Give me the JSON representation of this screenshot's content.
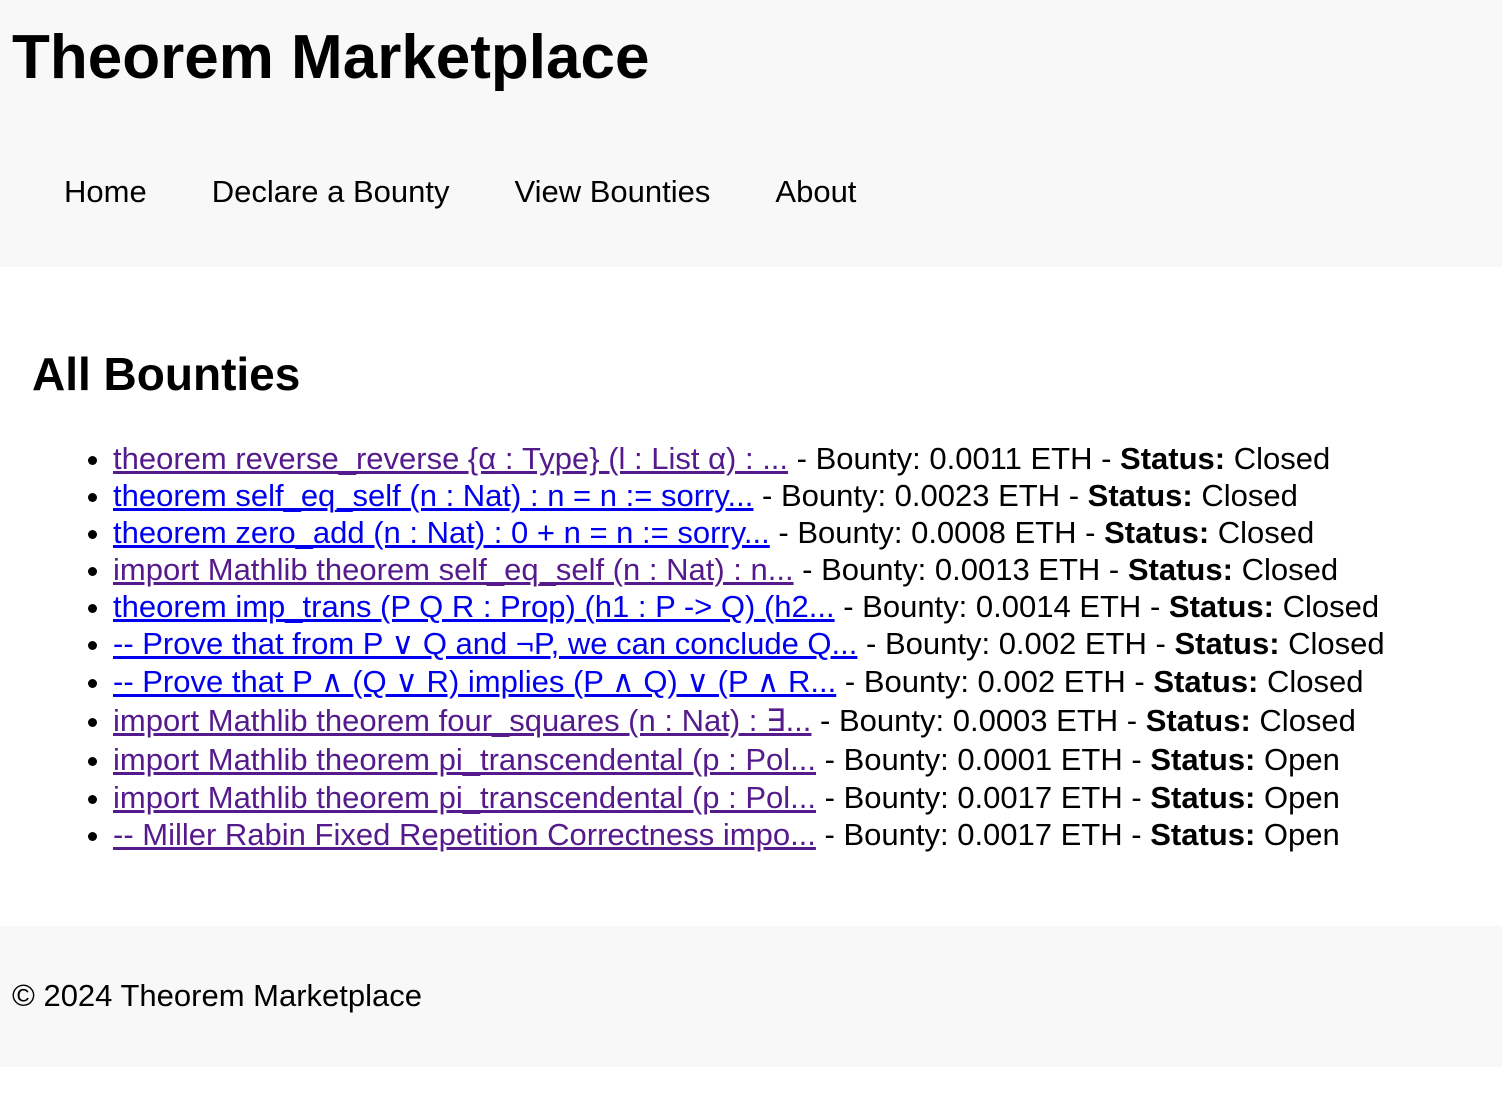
{
  "header": {
    "title": "Theorem Marketplace",
    "nav": [
      "Home",
      "Declare a Bounty",
      "View Bounties",
      "About"
    ]
  },
  "main": {
    "heading": "All Bounties",
    "bounties": [
      {
        "title": "theorem reverse_reverse {α : Type} (l : List α) : ...",
        "visited": true,
        "bounty_text": "Bounty: 0.0011 ETH",
        "status_label": "Status:",
        "status": "Closed"
      },
      {
        "title": "theorem self_eq_self (n : Nat) : n = n := sorry...",
        "visited": false,
        "bounty_text": "Bounty: 0.0023 ETH",
        "status_label": "Status:",
        "status": "Closed"
      },
      {
        "title": "theorem zero_add (n : Nat) : 0 + n = n := sorry...",
        "visited": false,
        "bounty_text": "Bounty: 0.0008 ETH",
        "status_label": "Status:",
        "status": "Closed"
      },
      {
        "title": "import Mathlib theorem self_eq_self (n : Nat) : n...",
        "visited": true,
        "bounty_text": "Bounty: 0.0013 ETH",
        "status_label": "Status:",
        "status": "Closed"
      },
      {
        "title": "theorem imp_trans (P Q R : Prop) (h1 : P -> Q) (h2...",
        "visited": false,
        "bounty_text": "Bounty: 0.0014 ETH",
        "status_label": "Status:",
        "status": "Closed"
      },
      {
        "title": "-- Prove that from P ∨ Q and ¬P, we can conclude Q...",
        "visited": false,
        "bounty_text": "Bounty: 0.002 ETH",
        "status_label": "Status:",
        "status": "Closed"
      },
      {
        "title": "-- Prove that P ∧ (Q ∨ R) implies (P ∧ Q) ∨ (P ∧ R...",
        "visited": false,
        "bounty_text": "Bounty: 0.002 ETH",
        "status_label": "Status:",
        "status": "Closed"
      },
      {
        "title": "import Mathlib theorem four_squares (n : Nat) : ∃...",
        "visited": true,
        "bounty_text": "Bounty: 0.0003 ETH",
        "status_label": "Status:",
        "status": "Closed"
      },
      {
        "title": "import Mathlib theorem pi_transcendental (p : Pol...",
        "visited": true,
        "bounty_text": "Bounty: 0.0001 ETH",
        "status_label": "Status:",
        "status": "Open"
      },
      {
        "title": "import Mathlib theorem pi_transcendental (p : Pol...",
        "visited": true,
        "bounty_text": "Bounty: 0.0017 ETH",
        "status_label": "Status:",
        "status": "Open"
      },
      {
        "title": "-- Miller Rabin Fixed Repetition Correctness impo...",
        "visited": true,
        "bounty_text": "Bounty: 0.0017 ETH",
        "status_label": "Status:",
        "status": "Open"
      }
    ]
  },
  "footer": {
    "text": "© 2024 Theorem Marketplace"
  },
  "colors": {
    "link_unvisited": "#0000ee",
    "link_visited": "#551a8b",
    "band_background": "#f8f8f8"
  }
}
